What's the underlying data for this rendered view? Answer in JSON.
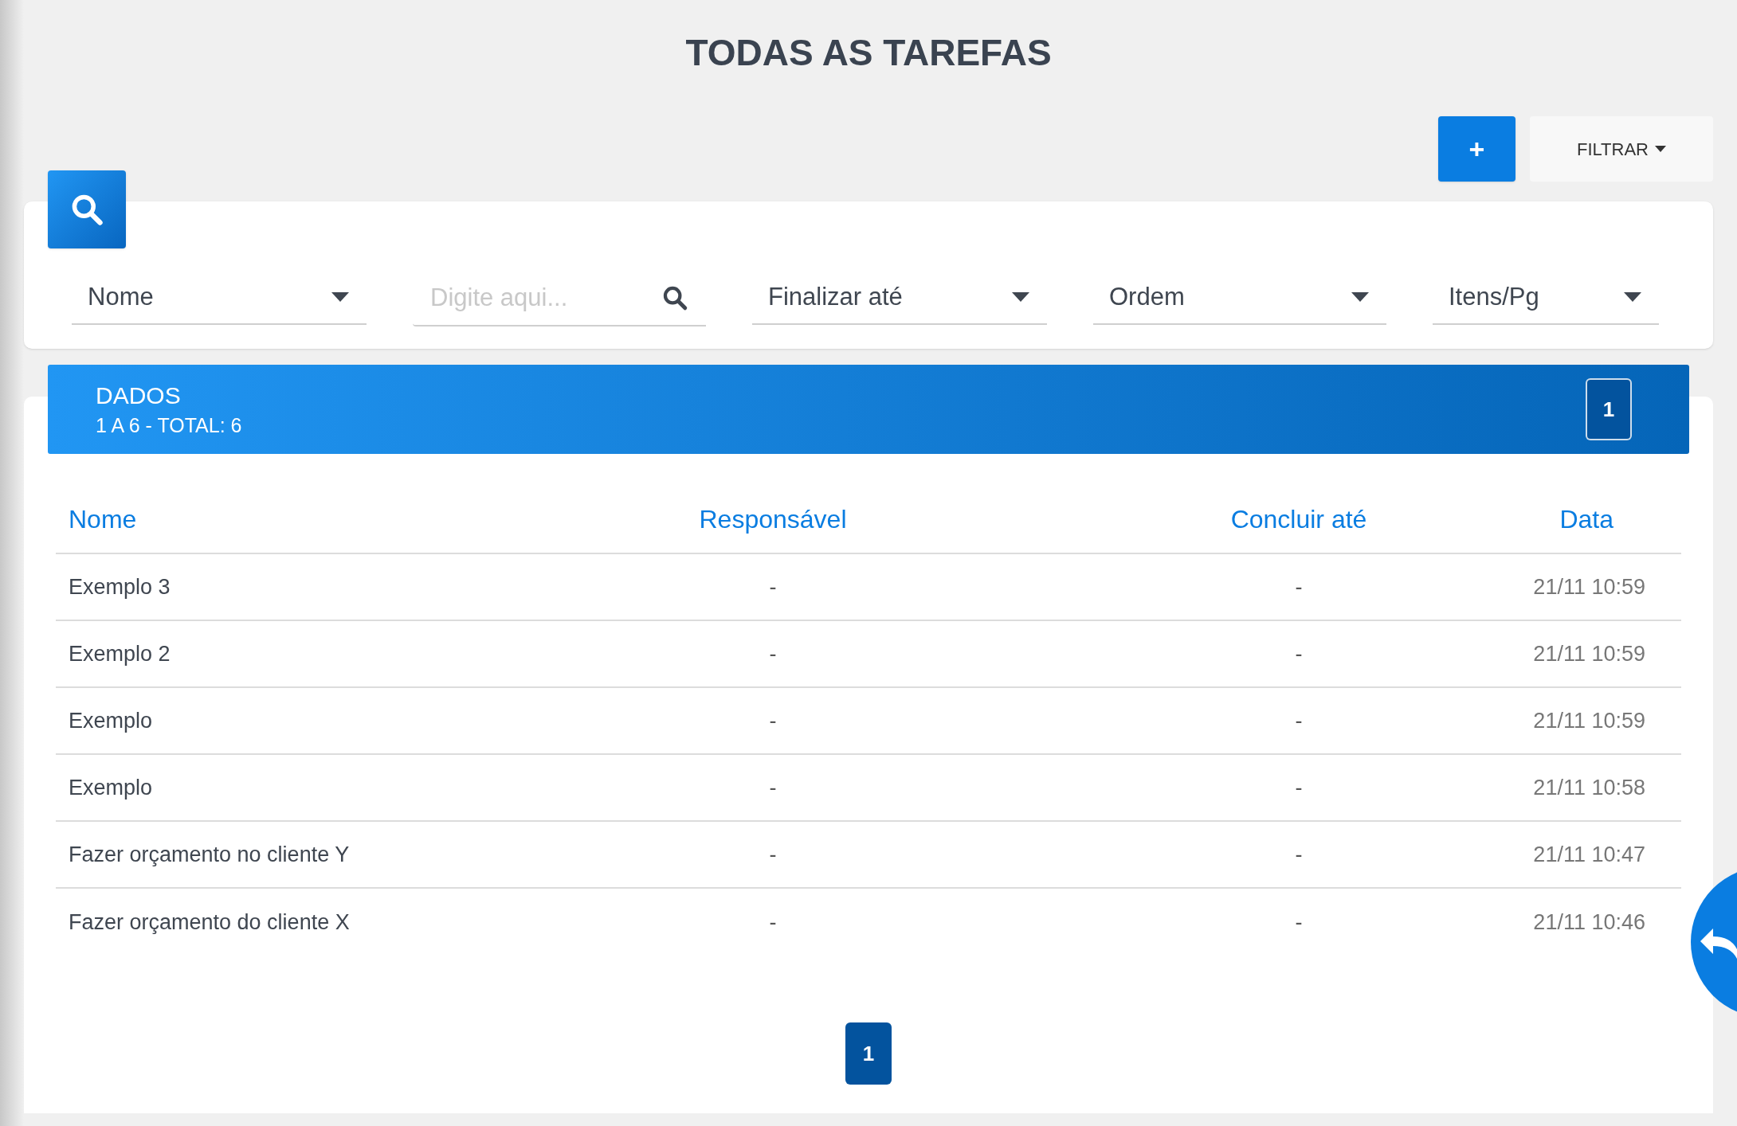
{
  "title": "TODAS AS TAREFAS",
  "actions": {
    "add": "+",
    "filter": "FILTRAR"
  },
  "filters": [
    {
      "kind": "select",
      "label": "Nome"
    },
    {
      "kind": "search",
      "placeholder": "Digite aqui..."
    },
    {
      "kind": "select",
      "label": "Finalizar até"
    },
    {
      "kind": "select",
      "label": "Ordem"
    },
    {
      "kind": "select",
      "label": "Itens/Pg"
    }
  ],
  "data_header": {
    "title": "DADOS",
    "range": "1 A 6 - TOTAL: 6",
    "page": "1"
  },
  "table": {
    "columns": [
      "Nome",
      "Responsável",
      "Concluir até",
      "Data"
    ],
    "rows": [
      [
        "Exemplo 3",
        "-",
        "-",
        "21/11 10:59"
      ],
      [
        "Exemplo 2",
        "-",
        "-",
        "21/11 10:59"
      ],
      [
        "Exemplo",
        "-",
        "-",
        "21/11 10:59"
      ],
      [
        "Exemplo",
        "-",
        "-",
        "21/11 10:58"
      ],
      [
        "Fazer orçamento no cliente Y",
        "-",
        "-",
        "21/11 10:47"
      ],
      [
        "Fazer orçamento do cliente X",
        "-",
        "-",
        "21/11 10:46"
      ]
    ]
  },
  "pagination": [
    {
      "label": "1",
      "selected": true
    }
  ]
}
